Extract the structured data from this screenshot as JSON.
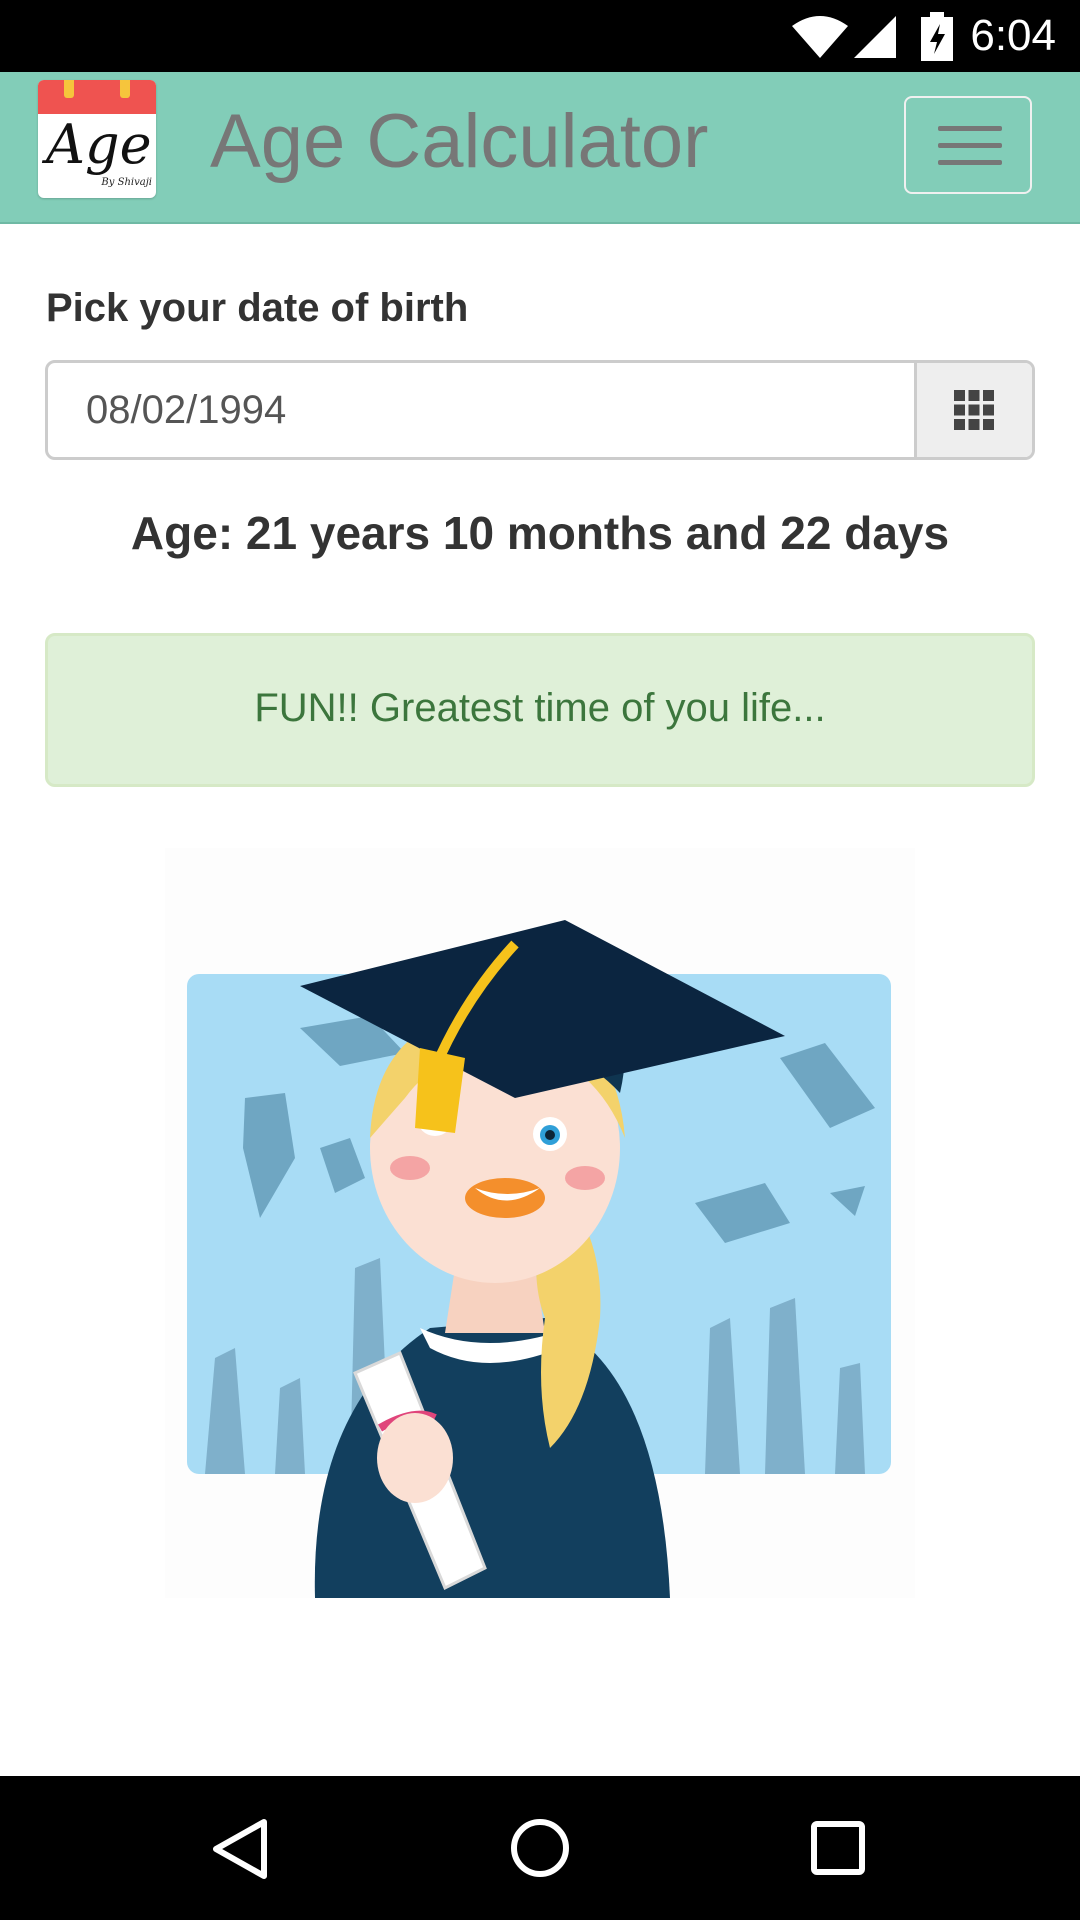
{
  "status_bar": {
    "time": "6:04"
  },
  "app_bar": {
    "title": "Age Calculator",
    "logo_text": "Age",
    "logo_subtext": "By Shivaji"
  },
  "form": {
    "label": "Pick your date of birth",
    "date_value": "08/02/1994"
  },
  "result": {
    "age_text": "Age: 21 years 10 months and 22 days"
  },
  "alert": {
    "message": "FUN!! Greatest time of you life..."
  },
  "icons": {
    "status": [
      "wifi-icon",
      "cell-signal-icon",
      "battery-charging-icon"
    ],
    "menu": "hamburger-menu-icon",
    "calendar": "grid-calendar-icon",
    "nav": [
      "back-icon",
      "home-icon",
      "recent-apps-icon"
    ]
  },
  "colors": {
    "app_bar": "#82cdb8",
    "alert_bg": "#dff0d8",
    "alert_text": "#3c763d",
    "title_text": "#777777"
  }
}
